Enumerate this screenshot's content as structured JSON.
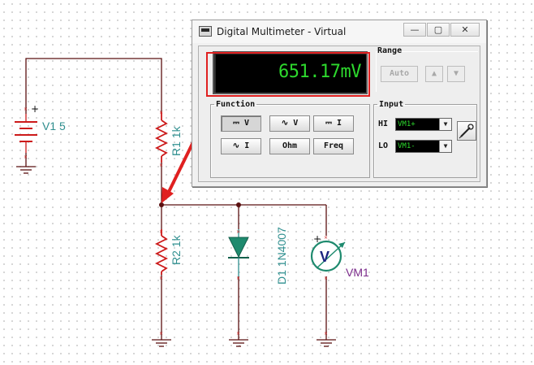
{
  "schematic": {
    "v1_label": "V1 5",
    "v1_plus": "+",
    "r1_label": "R1 1k",
    "r2_label": "R2 1k",
    "d1_label": "D1 1N4007",
    "vm_label": "VM1",
    "vm_symbol": "V",
    "vm_plus": "+",
    "colors": {
      "wire": "#5a1010",
      "component": "#cc1a1a",
      "teal": "#2f8f8f",
      "purple": "#7a2a8a",
      "arrow": "#e02020"
    }
  },
  "multimeter": {
    "title": "Digital Multimeter - Virtual",
    "window_buttons": {
      "minimize": "—",
      "maximize": "▢",
      "close": "✕"
    },
    "reading": "651.17mV",
    "range": {
      "label": "Range",
      "auto": "Auto",
      "up": "▲",
      "down": "▼"
    },
    "function": {
      "label": "Function",
      "buttons": {
        "dcv": "V",
        "acv": "V",
        "dci": "I",
        "aci": "I",
        "ohm": "Ohm",
        "freq": "Freq"
      },
      "selected": "dcv"
    },
    "input": {
      "label": "Input",
      "hi_label": "HI",
      "lo_label": "LO",
      "hi_value": "VM1+",
      "lo_value": "VM1-"
    }
  }
}
